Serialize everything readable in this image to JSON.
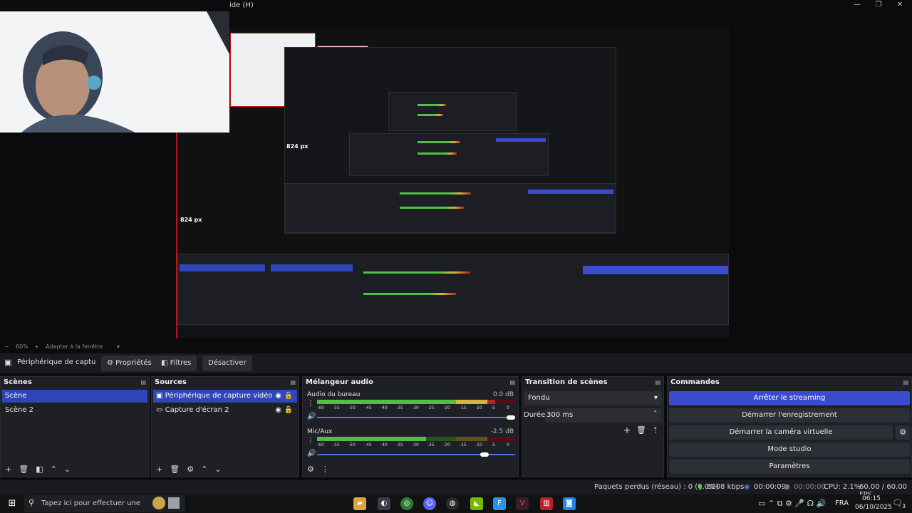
{
  "titlebar": {
    "menu_fragment": "ide (H)",
    "minimize": "—",
    "restore": "❐",
    "close": "✕"
  },
  "preview": {
    "size_label_outer": "824 px",
    "size_label_inner": "824 px"
  },
  "zoombar": {
    "minus": "−",
    "zoom": "60%",
    "plus": "+",
    "fit_label": "Adapter à la fenêtre"
  },
  "contextbar": {
    "source_name": "Périphérique de capture vi",
    "properties": "Propriétés",
    "filters": "Filtres",
    "deactivate": "Désactiver"
  },
  "scenes": {
    "title": "Scènes",
    "items": [
      "Scène",
      "Scène 2"
    ]
  },
  "sources": {
    "title": "Sources",
    "items": [
      "Périphérique de capture vidéo",
      "Capture d'écran 2"
    ]
  },
  "mixer": {
    "title": "Mélangeur audio",
    "channels": [
      {
        "name": "Audio du bureau",
        "db": "0.0 dB",
        "level": 0.9,
        "volume": 1.0
      },
      {
        "name": "Mic/Aux",
        "db": "-2.5 dB",
        "level": 0.55,
        "volume": 0.86
      }
    ],
    "scale": [
      "-60",
      "-55",
      "-50",
      "-45",
      "-40",
      "-35",
      "-30",
      "-25",
      "-20",
      "-15",
      "-10",
      "-5",
      "0"
    ]
  },
  "transitions": {
    "title": "Transition de scènes",
    "selected": "Fondu",
    "duration_label": "Durée",
    "duration_value": "300 ms"
  },
  "commands": {
    "title": "Commandes",
    "stop_streaming": "Arrêter le streaming",
    "start_recording": "Démarrer l'enregistrement",
    "start_virtual_cam": "Démarrer la caméra virtuelle",
    "studio_mode": "Mode studio",
    "settings": "Paramètres"
  },
  "status": {
    "dropped_frames": "Paquets perdus (réseau) : 0 (0.0%)",
    "bitrate": "6208 kbps",
    "stream_time": "00:00:09",
    "rec_time": "00:00:00",
    "cpu": "CPU: 2.1%",
    "fps": "60.00 / 60.00 FPS"
  },
  "taskbar": {
    "search_placeholder": "Tapez ici pour effectuer une",
    "time": "06:15",
    "date": "06/10/2025",
    "lang": "FRA",
    "notif_count": "3"
  },
  "colors": {
    "accent": "#2f46b8",
    "recording_border": "#c0161f",
    "meter_green": "#4ec240",
    "meter_yellow": "#d8b43a",
    "meter_red": "#b3242a"
  }
}
